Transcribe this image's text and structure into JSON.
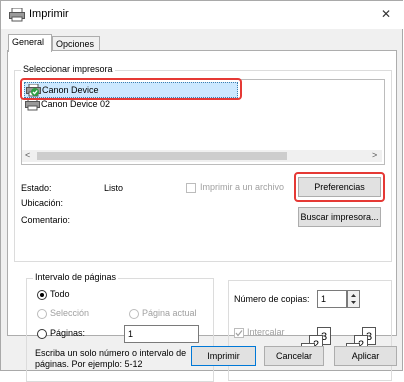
{
  "window": {
    "title": "Imprimir",
    "close_glyph": "✕"
  },
  "tabs": [
    {
      "label": "General"
    },
    {
      "label": "Opciones"
    }
  ],
  "printer_group": {
    "legend": "Seleccionar impresora",
    "printers": [
      {
        "name": "Canon Device"
      },
      {
        "name": "Canon Device 02"
      }
    ],
    "scroll_left": "<",
    "scroll_right": ">"
  },
  "status": {
    "estado_label": "Estado:",
    "estado_value": "Listo",
    "ubicacion_label": "Ubicación:",
    "comentario_label": "Comentario:",
    "print_to_file_label": "Imprimir a un archivo",
    "preferences_button": "Preferencias",
    "find_printer_button": "Buscar impresora..."
  },
  "page_range": {
    "legend": "Intervalo de páginas",
    "todo_label": "Todo",
    "seleccion_label": "Selección",
    "pagina_actual_label": "Página actual",
    "paginas_label": "Páginas:",
    "paginas_value": "1",
    "help_line1": "Escriba un solo número o intervalo de",
    "help_line2": "páginas. Por ejemplo: 5-12"
  },
  "copies": {
    "label": "Número de copias:",
    "value": "1",
    "intercalar_label": "Intercalar",
    "collate_pages": [
      "1",
      "2",
      "3"
    ]
  },
  "footer": {
    "print_button": "Imprimir",
    "cancel_button": "Cancelar",
    "apply_button": "Aplicar"
  },
  "colors": {
    "highlight": "#cce8ff",
    "annotation_red": "#e53935"
  }
}
